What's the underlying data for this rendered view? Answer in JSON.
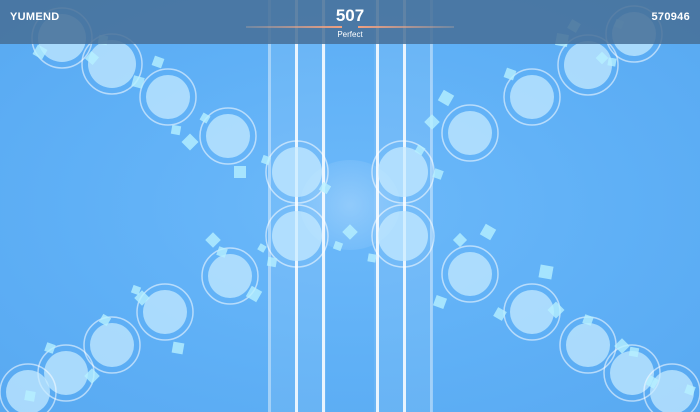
{
  "hud": {
    "player_name": "YUMEND",
    "score": "570946",
    "combo": "507",
    "judgement": "Perfect"
  },
  "colors": {
    "background": "#5eaff5",
    "topbar": "#466e96",
    "note_fill": "#c8ecff",
    "note_ring": "#ffffff",
    "particle": "#b6f0ff",
    "hp_bar": "#f0a080"
  }
}
